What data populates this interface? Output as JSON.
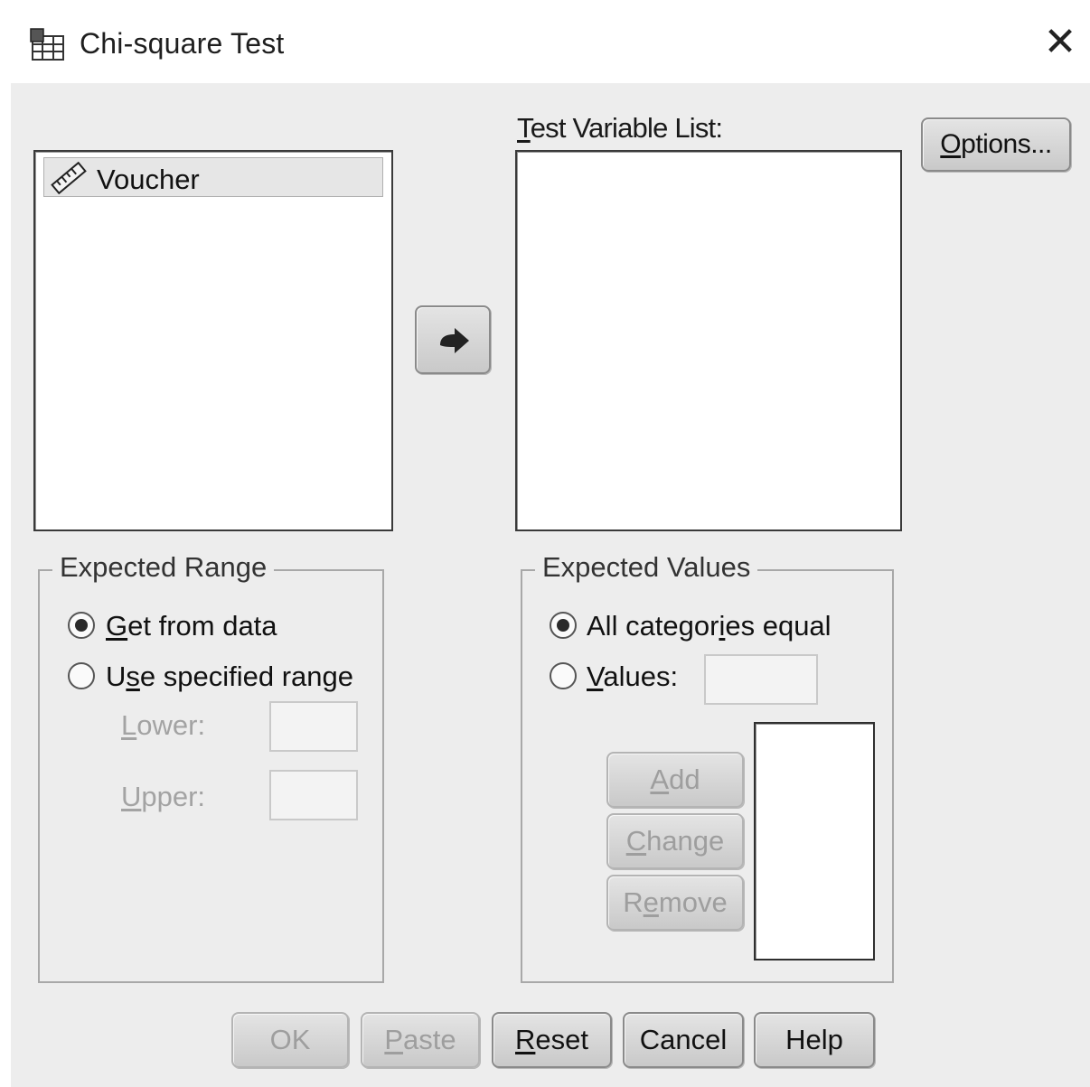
{
  "window": {
    "title": "Chi-square Test"
  },
  "source_list": {
    "items": [
      {
        "label": "Voucher",
        "icon": "scale-variable-icon"
      }
    ]
  },
  "test_variables": {
    "label": "Test Variable List:",
    "items": []
  },
  "buttons": {
    "options": "Options...",
    "move_arrow_icon": "arrow-right-icon"
  },
  "expected_range": {
    "title": "Expected Range",
    "get_from_data": "Get from data",
    "use_specified_range": "Use specified range",
    "lower_label": "Lower:",
    "upper_label": "Upper:",
    "lower_value": "",
    "upper_value": "",
    "selected": "get_from_data"
  },
  "expected_values": {
    "title": "Expected Values",
    "all_categories_equal": "All categories equal",
    "values_label": "Values:",
    "values_input": "",
    "selected": "all_categories_equal",
    "add": "Add",
    "change": "Change",
    "remove": "Remove",
    "values_list": []
  },
  "footer": {
    "ok": "OK",
    "paste": "Paste",
    "reset": "Reset",
    "cancel": "Cancel",
    "help": "Help"
  },
  "colors": {
    "dialog_bg": "#ededed",
    "disabled_text": "#a3a3a3"
  }
}
